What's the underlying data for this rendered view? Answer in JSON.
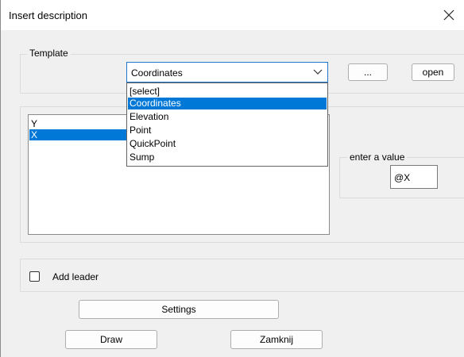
{
  "window": {
    "title": "Insert description"
  },
  "template": {
    "group_label": "Template",
    "selected_value": "Coordinates",
    "options": [
      "[select]",
      "Coordinates",
      "Elevation",
      "Point",
      "QuickPoint",
      "Sump"
    ],
    "selected_index": 1,
    "browse_label": "...",
    "open_label": "open"
  },
  "list": {
    "items": [
      "Y",
      "X"
    ],
    "selected_index": 1
  },
  "value": {
    "group_label": "enter a value",
    "current": "@X"
  },
  "leader": {
    "label": "Add leader",
    "checked": false
  },
  "buttons": {
    "settings": "Settings",
    "draw": "Draw",
    "close": "Zamknij"
  },
  "colors": {
    "selection": "#0078d7",
    "focus_border": "#2277cc"
  }
}
